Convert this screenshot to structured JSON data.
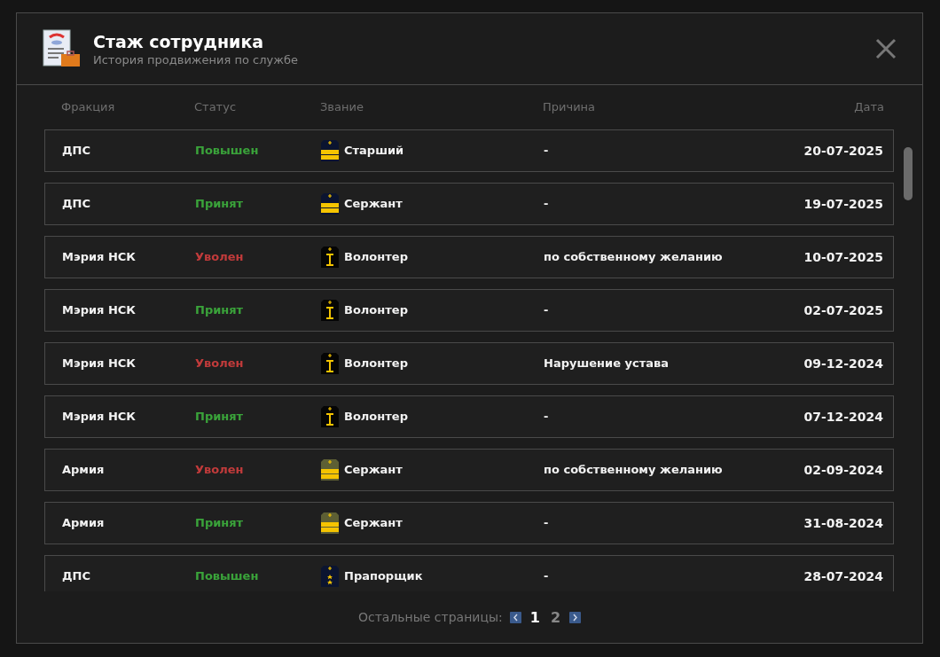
{
  "dialog": {
    "title": "Стаж сотрудника",
    "subtitle": "История продвижения по службе"
  },
  "table": {
    "columns": [
      "Фракция",
      "Статус",
      "Звание",
      "Причина",
      "Дата"
    ],
    "rows": [
      {
        "faction": "ДПС",
        "status": {
          "text": "Повышен",
          "kind": "positive"
        },
        "rank": {
          "text": "Старший",
          "kind": "navy-stripes"
        },
        "reason": "-",
        "date": "20-07-2025"
      },
      {
        "faction": "ДПС",
        "status": {
          "text": "Принят",
          "kind": "positive"
        },
        "rank": {
          "text": "Сержант",
          "kind": "navy-stripes"
        },
        "reason": "-",
        "date": "19-07-2025"
      },
      {
        "faction": "Мэрия НСК",
        "status": {
          "text": "Уволен",
          "kind": "negative"
        },
        "rank": {
          "text": "Волонтер",
          "kind": "black-bar"
        },
        "reason": "по собственному желанию",
        "date": "10-07-2025"
      },
      {
        "faction": "Мэрия НСК",
        "status": {
          "text": "Принят",
          "kind": "positive"
        },
        "rank": {
          "text": "Волонтер",
          "kind": "black-bar"
        },
        "reason": "-",
        "date": "02-07-2025"
      },
      {
        "faction": "Мэрия НСК",
        "status": {
          "text": "Уволен",
          "kind": "negative"
        },
        "rank": {
          "text": "Волонтер",
          "kind": "black-bar"
        },
        "reason": "Нарушение устава",
        "date": "09-12-2024"
      },
      {
        "faction": "Мэрия НСК",
        "status": {
          "text": "Принят",
          "kind": "positive"
        },
        "rank": {
          "text": "Волонтер",
          "kind": "black-bar"
        },
        "reason": "-",
        "date": "07-12-2024"
      },
      {
        "faction": "Армия",
        "status": {
          "text": "Уволен",
          "kind": "negative"
        },
        "rank": {
          "text": "Сержант",
          "kind": "olive-stripes"
        },
        "reason": "по собственному желанию",
        "date": "02-09-2024"
      },
      {
        "faction": "Армия",
        "status": {
          "text": "Принят",
          "kind": "positive"
        },
        "rank": {
          "text": "Сержант",
          "kind": "olive-stripes"
        },
        "reason": "-",
        "date": "31-08-2024"
      },
      {
        "faction": "ДПС",
        "status": {
          "text": "Повышен",
          "kind": "positive"
        },
        "rank": {
          "text": "Прапорщик",
          "kind": "navy-stars"
        },
        "reason": "-",
        "date": "28-07-2024"
      }
    ]
  },
  "pagination": {
    "label": "Остальные страницы:",
    "pages": [
      {
        "label": "1",
        "selected": true
      },
      {
        "label": "2",
        "selected": false
      }
    ]
  }
}
